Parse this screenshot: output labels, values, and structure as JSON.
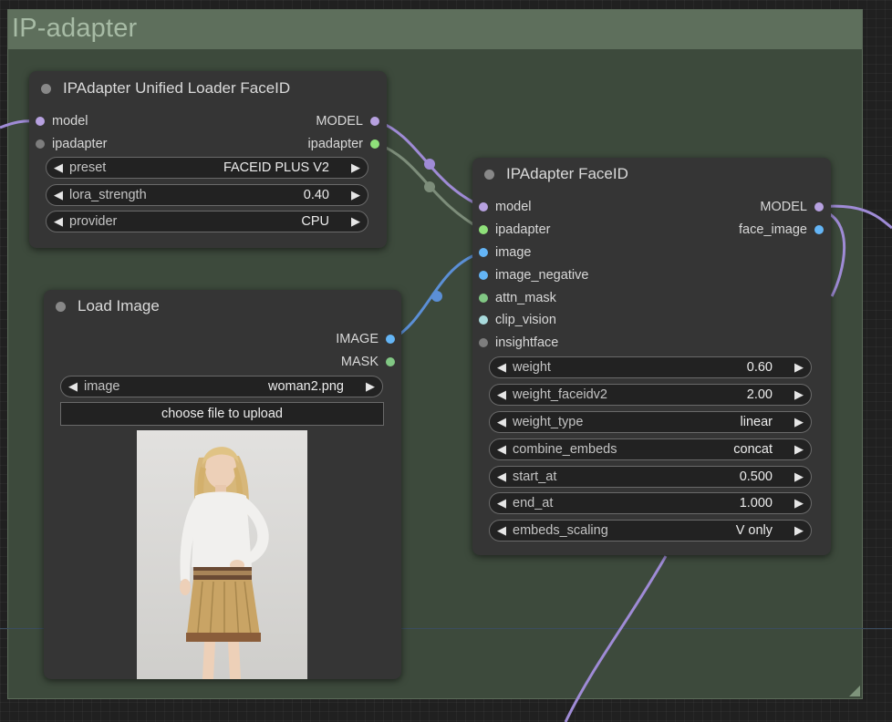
{
  "group": {
    "title": "IP-adapter"
  },
  "colors": {
    "model": "#b7a1e0",
    "ipadapter": "#8fe07a",
    "image": "#64b5f6",
    "mask": "#81c784",
    "clip_vision": "#a8dadc",
    "insightface": "#7d7d7d",
    "link_model": "#9f8bd6",
    "link_ipadapter": "#7d8d7a",
    "link_image": "#5b8fd6"
  },
  "loader_node": {
    "title": "IPAdapter Unified Loader FaceID",
    "inputs": [
      {
        "label": "model",
        "color": "#b7a1e0"
      },
      {
        "label": "ipadapter",
        "color": "#7d7d7d"
      }
    ],
    "outputs": [
      {
        "label": "MODEL",
        "color": "#b7a1e0"
      },
      {
        "label": "ipadapter",
        "color": "#8fe07a"
      }
    ],
    "widgets": [
      {
        "label": "preset",
        "value": "FACEID PLUS V2"
      },
      {
        "label": "lora_strength",
        "value": "0.40"
      },
      {
        "label": "provider",
        "value": "CPU"
      }
    ]
  },
  "load_image_node": {
    "title": "Load Image",
    "outputs": [
      {
        "label": "IMAGE",
        "color": "#64b5f6"
      },
      {
        "label": "MASK",
        "color": "#81c784"
      }
    ],
    "widgets": [
      {
        "label": "image",
        "value": "woman2.png"
      }
    ],
    "upload_label": "choose file to upload",
    "preview_icon": "woman-portrait-image"
  },
  "faceid_node": {
    "title": "IPAdapter FaceID",
    "inputs": [
      {
        "label": "model",
        "color": "#b7a1e0"
      },
      {
        "label": "ipadapter",
        "color": "#8fe07a"
      },
      {
        "label": "image",
        "color": "#64b5f6"
      },
      {
        "label": "image_negative",
        "color": "#64b5f6"
      },
      {
        "label": "attn_mask",
        "color": "#81c784"
      },
      {
        "label": "clip_vision",
        "color": "#a8dadc"
      },
      {
        "label": "insightface",
        "color": "#7d7d7d"
      }
    ],
    "outputs": [
      {
        "label": "MODEL",
        "color": "#b7a1e0"
      },
      {
        "label": "face_image",
        "color": "#64b5f6"
      }
    ],
    "widgets": [
      {
        "label": "weight",
        "value": "0.60"
      },
      {
        "label": "weight_faceidv2",
        "value": "2.00"
      },
      {
        "label": "weight_type",
        "value": "linear"
      },
      {
        "label": "combine_embeds",
        "value": "concat"
      },
      {
        "label": "start_at",
        "value": "0.500"
      },
      {
        "label": "end_at",
        "value": "1.000"
      },
      {
        "label": "embeds_scaling",
        "value": "V only"
      }
    ]
  }
}
